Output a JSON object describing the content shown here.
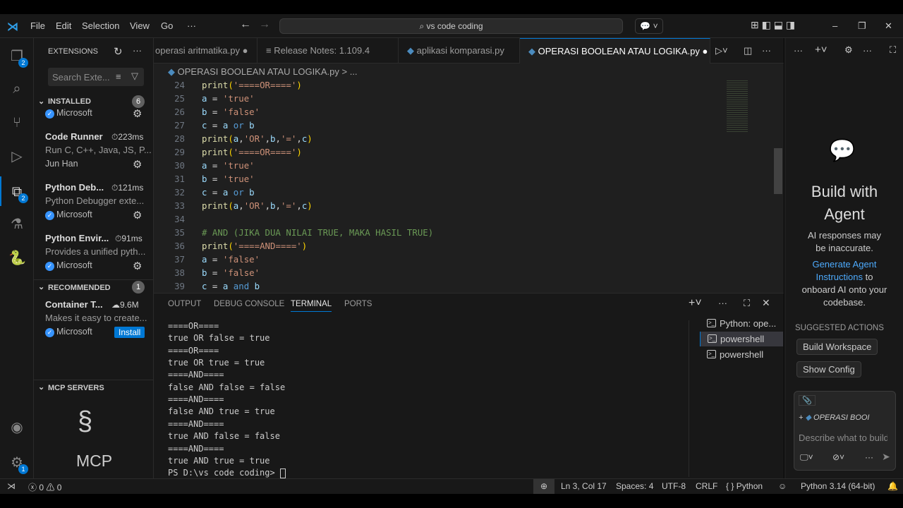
{
  "titlebar": {
    "menus": [
      "File",
      "Edit",
      "Selection",
      "View",
      "Go",
      "···"
    ],
    "search": "vs code coding"
  },
  "activity": {
    "explorer_badge": "2",
    "extensions_badge": "2",
    "settings_badge": "1"
  },
  "sidebar": {
    "title": "EXTENSIONS",
    "search_placeholder": "Search Exte...",
    "installed": {
      "label": "INSTALLED",
      "count": "6"
    },
    "first_publisher": "Microsoft",
    "extensions": [
      {
        "name": "Code Runner",
        "time": "223ms",
        "desc": "Run C, C++, Java, JS, P...",
        "publisher": "Jun Han",
        "verified": false
      },
      {
        "name": "Python Deb...",
        "time": "121ms",
        "desc": "Python Debugger exte...",
        "publisher": "Microsoft",
        "verified": true
      },
      {
        "name": "Python Envir...",
        "time": "91ms",
        "desc": "Provides a unified pyth...",
        "publisher": "Microsoft",
        "verified": true
      }
    ],
    "recommended": {
      "label": "RECOMMENDED",
      "count": "1",
      "name": "Container T...",
      "downloads": "9.6M",
      "desc": "Makes it easy to create...",
      "publisher": "Microsoft",
      "install": "Install"
    },
    "mcp": {
      "label": "MCP SERVERS",
      "logo_text": "MCP"
    }
  },
  "tabs": [
    {
      "label": "operasi aritmatika.py",
      "dirty": true
    },
    {
      "label": "Release Notes: 1.109.4"
    },
    {
      "label": "aplikasi komparasi.py"
    },
    {
      "label": "OPERASI BOOLEAN ATAU LOGIKA.py",
      "active": true,
      "dirty": true
    }
  ],
  "breadcrumb": {
    "file": "OPERASI BOOLEAN ATAU LOGIKA.py",
    "rest": "> ..."
  },
  "code": [
    {
      "n": "24",
      "t": [
        [
          "print",
          "fn"
        ],
        [
          "(",
          "pn"
        ],
        [
          "'====OR===='",
          "st"
        ],
        [
          ")",
          "pn"
        ]
      ]
    },
    {
      "n": "25",
      "t": [
        [
          "a",
          "vr"
        ],
        [
          " = ",
          "op"
        ],
        [
          "'true'",
          "st"
        ]
      ]
    },
    {
      "n": "26",
      "t": [
        [
          "b",
          "vr"
        ],
        [
          " = ",
          "op"
        ],
        [
          "'false'",
          "st"
        ]
      ]
    },
    {
      "n": "27",
      "t": [
        [
          "c",
          "vr"
        ],
        [
          " = ",
          "op"
        ],
        [
          "a",
          "vr"
        ],
        [
          " or ",
          "kw"
        ],
        [
          "b",
          "vr"
        ]
      ]
    },
    {
      "n": "28",
      "t": [
        [
          "print",
          "fn"
        ],
        [
          "(",
          "pn"
        ],
        [
          "a",
          "vr"
        ],
        [
          ",",
          "op"
        ],
        [
          "'OR'",
          "st"
        ],
        [
          ",",
          "op"
        ],
        [
          "b",
          "vr"
        ],
        [
          ",",
          "op"
        ],
        [
          "'='",
          "st"
        ],
        [
          ",",
          "op"
        ],
        [
          "c",
          "vr"
        ],
        [
          ")",
          "pn"
        ]
      ]
    },
    {
      "n": "29",
      "t": [
        [
          "print",
          "fn"
        ],
        [
          "(",
          "pn"
        ],
        [
          "'====OR===='",
          "st"
        ],
        [
          ")",
          "pn"
        ]
      ]
    },
    {
      "n": "30",
      "t": [
        [
          "a",
          "vr"
        ],
        [
          " = ",
          "op"
        ],
        [
          "'true'",
          "st"
        ]
      ]
    },
    {
      "n": "31",
      "t": [
        [
          "b",
          "vr"
        ],
        [
          " = ",
          "op"
        ],
        [
          "'true'",
          "st"
        ]
      ]
    },
    {
      "n": "32",
      "t": [
        [
          "c",
          "vr"
        ],
        [
          " = ",
          "op"
        ],
        [
          "a",
          "vr"
        ],
        [
          " or ",
          "kw"
        ],
        [
          "b",
          "vr"
        ]
      ]
    },
    {
      "n": "33",
      "t": [
        [
          "print",
          "fn"
        ],
        [
          "(",
          "pn"
        ],
        [
          "a",
          "vr"
        ],
        [
          ",",
          "op"
        ],
        [
          "'OR'",
          "st"
        ],
        [
          ",",
          "op"
        ],
        [
          "b",
          "vr"
        ],
        [
          ",",
          "op"
        ],
        [
          "'='",
          "st"
        ],
        [
          ",",
          "op"
        ],
        [
          "c",
          "vr"
        ],
        [
          ")",
          "pn"
        ]
      ]
    },
    {
      "n": "34",
      "t": []
    },
    {
      "n": "35",
      "t": [
        [
          "# AND (JIKA DUA NILAI TRUE, MAKA HASIL TRUE)",
          "cm"
        ]
      ]
    },
    {
      "n": "36",
      "t": [
        [
          "print",
          "fn"
        ],
        [
          "(",
          "pn"
        ],
        [
          "'====AND===='",
          "st"
        ],
        [
          ")",
          "pn"
        ]
      ]
    },
    {
      "n": "37",
      "t": [
        [
          "a",
          "vr"
        ],
        [
          " = ",
          "op"
        ],
        [
          "'false'",
          "st"
        ]
      ]
    },
    {
      "n": "38",
      "t": [
        [
          "b",
          "vr"
        ],
        [
          " = ",
          "op"
        ],
        [
          "'false'",
          "st"
        ]
      ]
    },
    {
      "n": "39",
      "t": [
        [
          "c",
          "vr"
        ],
        [
          " = ",
          "op"
        ],
        [
          "a",
          "vr"
        ],
        [
          " and ",
          "kw"
        ],
        [
          "b",
          "vr"
        ]
      ]
    }
  ],
  "panel": {
    "tabs": [
      "OUTPUT",
      "DEBUG CONSOLE",
      "TERMINAL",
      "PORTS"
    ],
    "active": "TERMINAL",
    "terminal": [
      "====OR====",
      "true OR false = true",
      "====OR====",
      "true OR true = true",
      "====AND====",
      "false AND false = false",
      "====AND====",
      "false AND true = true",
      "====AND====",
      "true AND false = false",
      "====AND====",
      "true AND true = true",
      "PS D:\\vs code coding> "
    ],
    "terminals": [
      "Python: ope...",
      "powershell",
      "powershell"
    ]
  },
  "chat": {
    "title": "Build with Agent",
    "disclaimer": "AI responses may be inaccurate.",
    "link": "Generate Agent Instructions",
    "link_rest": " to onboard AI onto your codebase.",
    "suggested": "SUGGESTED ACTIONS",
    "actions": [
      "Build Workspace",
      "Show Config"
    ],
    "context": "OPERASI BOOI",
    "placeholder": "Describe what to build"
  },
  "status": {
    "errors": "0",
    "warnings": "0",
    "position": "Ln 3, Col 17",
    "spaces": "Spaces: 4",
    "encoding": "UTF-8",
    "eol": "CRLF",
    "language": "Python",
    "interpreter": "Python 3.14 (64-bit)"
  }
}
